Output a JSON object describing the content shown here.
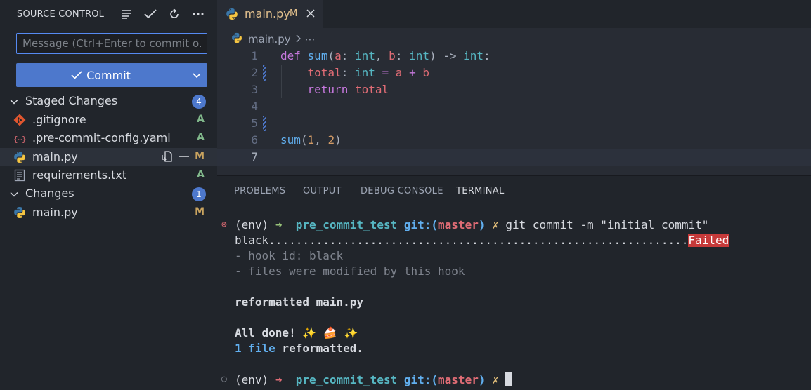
{
  "sidebar": {
    "title": "SOURCE CONTROL",
    "actions": [
      "list-icon",
      "check-icon",
      "refresh-icon",
      "more-icon"
    ],
    "message_placeholder": "Message (Ctrl+Enter to commit o…",
    "commit_label": "Commit",
    "staged": {
      "label": "Staged Changes",
      "count": "4",
      "files": [
        {
          "name": ".gitignore",
          "status": "A",
          "icon": "git-icon"
        },
        {
          "name": ".pre-commit-config.yaml",
          "status": "A",
          "icon": "yaml-icon"
        },
        {
          "name": "main.py",
          "status": "M",
          "icon": "python-icon"
        },
        {
          "name": "requirements.txt",
          "status": "A",
          "icon": "text-file-icon"
        }
      ]
    },
    "changes": {
      "label": "Changes",
      "count": "1",
      "files": [
        {
          "name": "main.py",
          "status": "M",
          "icon": "python-icon"
        }
      ]
    }
  },
  "editor": {
    "tab": {
      "label": "main.py",
      "modified": "M"
    },
    "breadcrumb": {
      "file": "main.py",
      "more": "⋯"
    },
    "line_numbers": [
      "1",
      "2",
      "3",
      "4",
      "5",
      "6",
      "7"
    ]
  },
  "panel": {
    "tabs": [
      "PROBLEMS",
      "OUTPUT",
      "DEBUG CONSOLE",
      "TERMINAL"
    ],
    "active_tab": "TERMINAL",
    "terminal": {
      "prompt1": {
        "env": "(env)",
        "arrow": "➜",
        "dir": "pre_commit_test",
        "git": "git:(",
        "branch": "master",
        "git_close": ")",
        "dirty": "✗",
        "command": "git commit -m \"initial commit\""
      },
      "hook_name": "black",
      "hook_dots": "..............................................................",
      "hook_result": "Failed",
      "hook_id_line": "- hook id: black",
      "hook_files_line": "- files were modified by this hook",
      "reformatted": "reformatted main.py",
      "all_done": "All done! ✨ 🍰 ✨",
      "summary_count": "1 file",
      "summary_rest": " reformatted.",
      "prompt2": {
        "env": "(env)",
        "arrow": "➜",
        "dir": "pre_commit_test",
        "git": "git:(",
        "branch": "master",
        "git_close": ")",
        "dirty": "✗"
      }
    }
  },
  "colors": {
    "accent": "#4d78cc",
    "added": "#81b88b",
    "modified": "#c9a35f",
    "failed_bg": "#c63a3a"
  }
}
